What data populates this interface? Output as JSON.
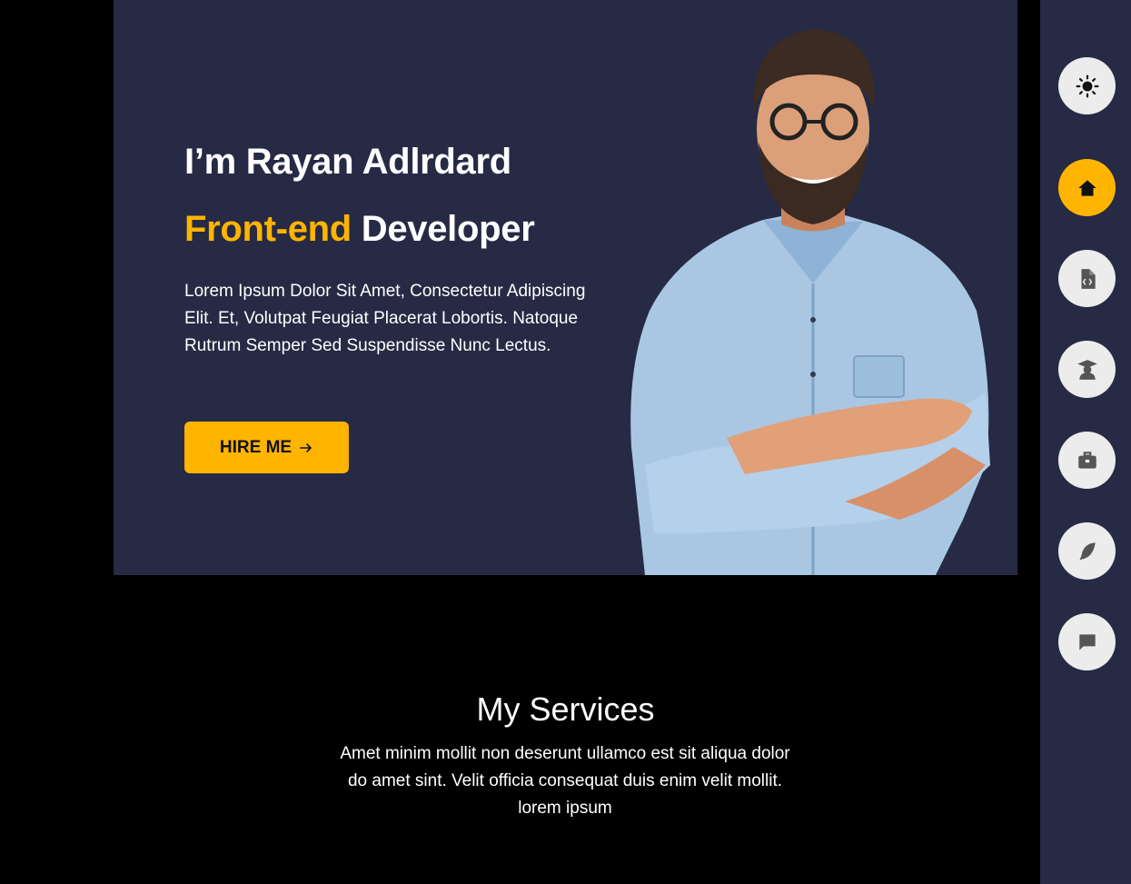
{
  "hero": {
    "greeting": "I’m Rayan Adlrdard",
    "role_accent": "Front-end",
    "role_rest": "Developer",
    "description": "Lorem Ipsum Dolor Sit Amet, Consectetur Adipiscing Elit. Et, Volutpat Feugiat Placerat Lobortis. Natoque Rutrum Semper Sed Suspendisse Nunc Lectus.",
    "hire_button": "HIRE ME"
  },
  "services": {
    "title": "My Services",
    "description": "Amet minim mollit non deserunt ullamco est sit aliqua dolor do amet sint. Velit officia consequat duis enim velit mollit. lorem ipsum"
  },
  "sidebar": {
    "items": [
      {
        "icon": "sun-icon",
        "active": false
      },
      {
        "icon": "home-icon",
        "active": true
      },
      {
        "icon": "code-file-icon",
        "active": false
      },
      {
        "icon": "graduate-icon",
        "active": false
      },
      {
        "icon": "briefcase-icon",
        "active": false
      },
      {
        "icon": "feather-icon",
        "active": false
      },
      {
        "icon": "chat-icon",
        "active": false
      }
    ]
  },
  "colors": {
    "accent": "#ffb400",
    "panel": "#262a44",
    "background": "#000000"
  }
}
